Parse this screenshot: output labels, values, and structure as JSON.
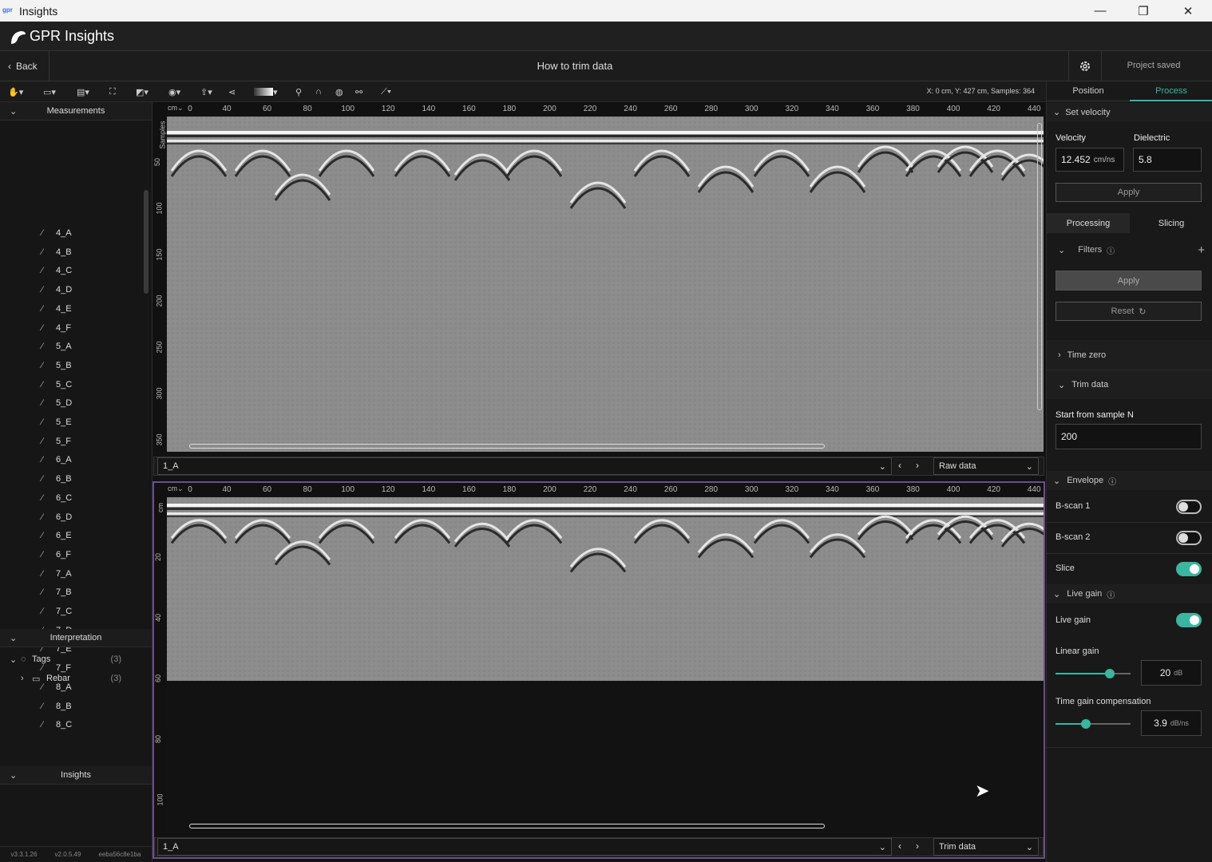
{
  "window": {
    "logo": "gpr",
    "title": "Insights",
    "minimize": "—",
    "restore": "❐",
    "close": "✕"
  },
  "app": {
    "name": "GPR Insights"
  },
  "nav": {
    "back": "Back",
    "title": "How to trim data",
    "status": "Project saved"
  },
  "toolbar": {
    "coords": "X: 0 cm, Y: 427 cm, Samples: 364"
  },
  "left": {
    "measurements_header": "Measurements",
    "measurements": [
      "4_A",
      "4_B",
      "4_C",
      "4_D",
      "4_E",
      "4_F",
      "5_A",
      "5_B",
      "5_C",
      "5_D",
      "5_E",
      "5_F",
      "6_A",
      "6_B",
      "6_C",
      "6_D",
      "6_E",
      "6_F",
      "7_A",
      "7_B",
      "7_C",
      "7_D",
      "7_E",
      "7_F",
      "8_A",
      "8_B",
      "8_C"
    ],
    "interpretation_header": "Interpretation",
    "tags_label": "Tags",
    "tags_count": "(3)",
    "rebar_label": "Rebar",
    "rebar_count": "(3)",
    "insights_header": "Insights",
    "versions": [
      "v3.3.1.26",
      "v2.0.5.49",
      "eeba56c8e1ba"
    ]
  },
  "ruler": {
    "unit": "cm",
    "ticks": [
      "0",
      "40",
      "60",
      "80",
      "100",
      "120",
      "140",
      "160",
      "180",
      "200",
      "220",
      "240",
      "260",
      "280",
      "300",
      "320",
      "340",
      "360",
      "380",
      "400",
      "420",
      "440"
    ]
  },
  "view1": {
    "yunit": "Samples",
    "yticks": [
      "50",
      "100",
      "150",
      "200",
      "250",
      "300",
      "350"
    ],
    "scan_name": "1_A",
    "mode": "Raw data"
  },
  "view2": {
    "yunit": "cm",
    "yticks": [
      "20",
      "40",
      "60",
      "80",
      "100"
    ],
    "scan_name": "1_A",
    "mode": "Trim data"
  },
  "right": {
    "tab_position": "Position",
    "tab_process": "Process",
    "set_velocity": "Set velocity",
    "velocity_label": "Velocity",
    "velocity_value": "12.452",
    "velocity_unit": "cm/ns",
    "dielectric_label": "Dielectric",
    "dielectric_value": "5.8",
    "apply": "Apply",
    "tab_processing": "Processing",
    "tab_slicing": "Slicing",
    "filters": "Filters",
    "apply2": "Apply",
    "reset": "Reset",
    "time_zero": "Time zero",
    "trim_data": "Trim data",
    "start_sample_label": "Start from sample N",
    "start_sample_value": "200",
    "envelope": "Envelope",
    "bscan1": "B-scan 1",
    "bscan2": "B-scan 2",
    "slice": "Slice",
    "live_gain_header": "Live gain",
    "live_gain": "Live gain",
    "linear_gain": "Linear gain",
    "linear_gain_value": "20",
    "linear_gain_unit": "dB",
    "tgc": "Time gain compensation",
    "tgc_value": "3.9",
    "tgc_unit": "dB/ns"
  },
  "colors": {
    "accent": "#3bb5a0",
    "purple_frame": "#6a4f8a"
  }
}
